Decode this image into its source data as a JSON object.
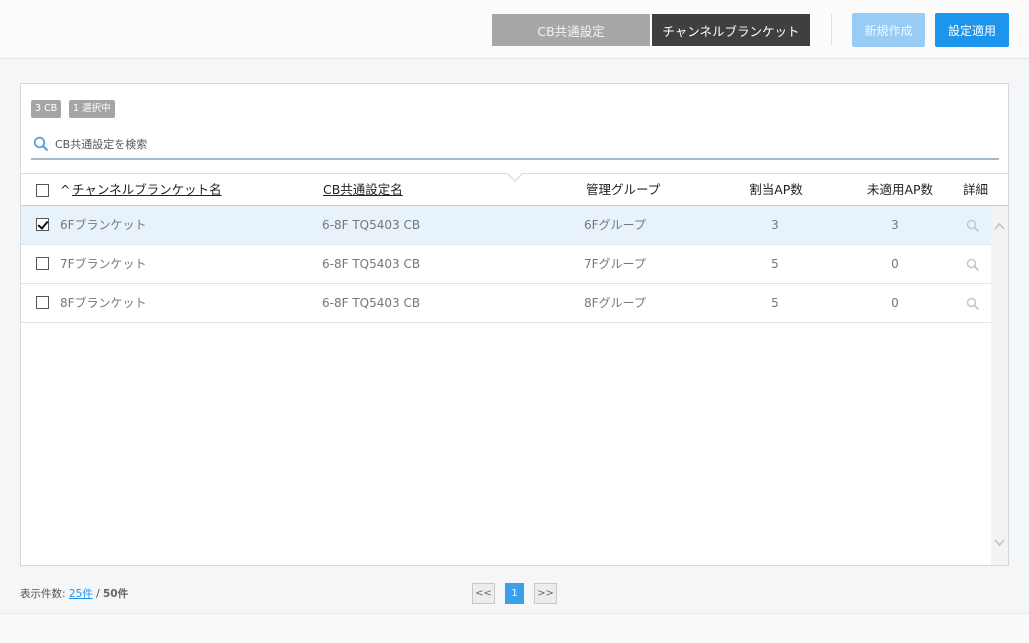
{
  "toolbar": {
    "tab_cb_common": "CB共通設定",
    "tab_channel_blanket": "チャンネルブランケット",
    "new_button": "新規作成",
    "apply_button": "設定適用"
  },
  "panel": {
    "badge_count": "3 CB",
    "badge_selected": "1 選択中",
    "search_placeholder": "CB共通設定を検索"
  },
  "table": {
    "sort_indicator": "^",
    "headers": {
      "name": "チャンネルブランケット名",
      "cb_common": "CB共通設定名",
      "group": "管理グループ",
      "assigned_ap": "割当AP数",
      "unapplied_ap": "未適用AP数",
      "detail": "詳細"
    },
    "rows": [
      {
        "checked": true,
        "name": "6Fブランケット",
        "cb_common": "6-8F TQ5403 CB",
        "group": "6Fグループ",
        "assigned_ap": "3",
        "unapplied_ap": "3"
      },
      {
        "checked": false,
        "name": "7Fブランケット",
        "cb_common": "6-8F TQ5403 CB",
        "group": "7Fグループ",
        "assigned_ap": "5",
        "unapplied_ap": "0"
      },
      {
        "checked": false,
        "name": "8Fブランケット",
        "cb_common": "6-8F TQ5403 CB",
        "group": "8Fグループ",
        "assigned_ap": "5",
        "unapplied_ap": "0"
      }
    ]
  },
  "footer": {
    "display_count_label": "表示件数:",
    "page_size": "25件",
    "separator": "/",
    "total": "50件"
  },
  "pagination": {
    "first": "<<",
    "current": "1",
    "last": ">>"
  },
  "colors": {
    "accent": "#1e95ec",
    "selected_row": "#e8f2fb",
    "tab_active": "#3f3f3f",
    "tab_inactive": "#a7a7a7"
  },
  "icons": {
    "search": "search-icon",
    "detail": "magnifier-icon",
    "scroll_up": "chevron-up-icon",
    "scroll_down": "chevron-down-icon"
  }
}
